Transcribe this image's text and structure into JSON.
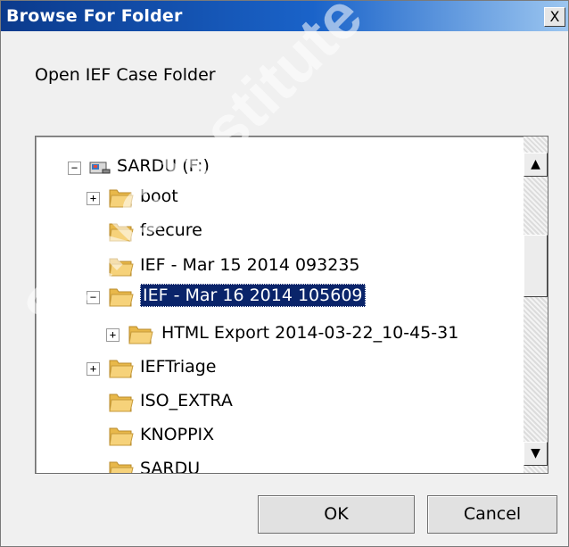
{
  "window": {
    "title": "Browse For Folder",
    "close_glyph": "X"
  },
  "prompt": "Open IEF Case Folder",
  "tree": [
    {
      "label": "SARDU (F:)",
      "expander": "−",
      "icon": "drive-icon",
      "selected": false
    },
    {
      "label": "boot",
      "expander": "+",
      "icon": "folder-icon",
      "selected": false
    },
    {
      "label": "fsecure",
      "expander": "",
      "icon": "folder-icon",
      "selected": false
    },
    {
      "label": "IEF - Mar 15 2014 093235",
      "expander": "",
      "icon": "folder-icon",
      "selected": false
    },
    {
      "label": "IEF - Mar 16 2014 105609",
      "expander": "−",
      "icon": "folder-icon",
      "selected": true
    },
    {
      "label": "HTML Export 2014-03-22_10-45-31",
      "expander": "+",
      "icon": "folder-icon",
      "selected": false
    },
    {
      "label": "IEFTriage",
      "expander": "+",
      "icon": "folder-icon",
      "selected": false
    },
    {
      "label": "ISO_EXTRA",
      "expander": "",
      "icon": "folder-icon",
      "selected": false
    },
    {
      "label": "KNOPPIX",
      "expander": "",
      "icon": "folder-icon",
      "selected": false
    },
    {
      "label": "SARDU",
      "expander": "",
      "icon": "folder-icon",
      "selected": false
    }
  ],
  "scrollbar": {
    "up_glyph": "▲",
    "down_glyph": "▼"
  },
  "buttons": {
    "ok": "OK",
    "cancel": "Cancel"
  },
  "watermark": "SANS Institute",
  "colors": {
    "title_start": "#0b3a8c",
    "title_end": "#9cc6f0",
    "selection": "#0a246a",
    "folder": "#e8b84a"
  }
}
